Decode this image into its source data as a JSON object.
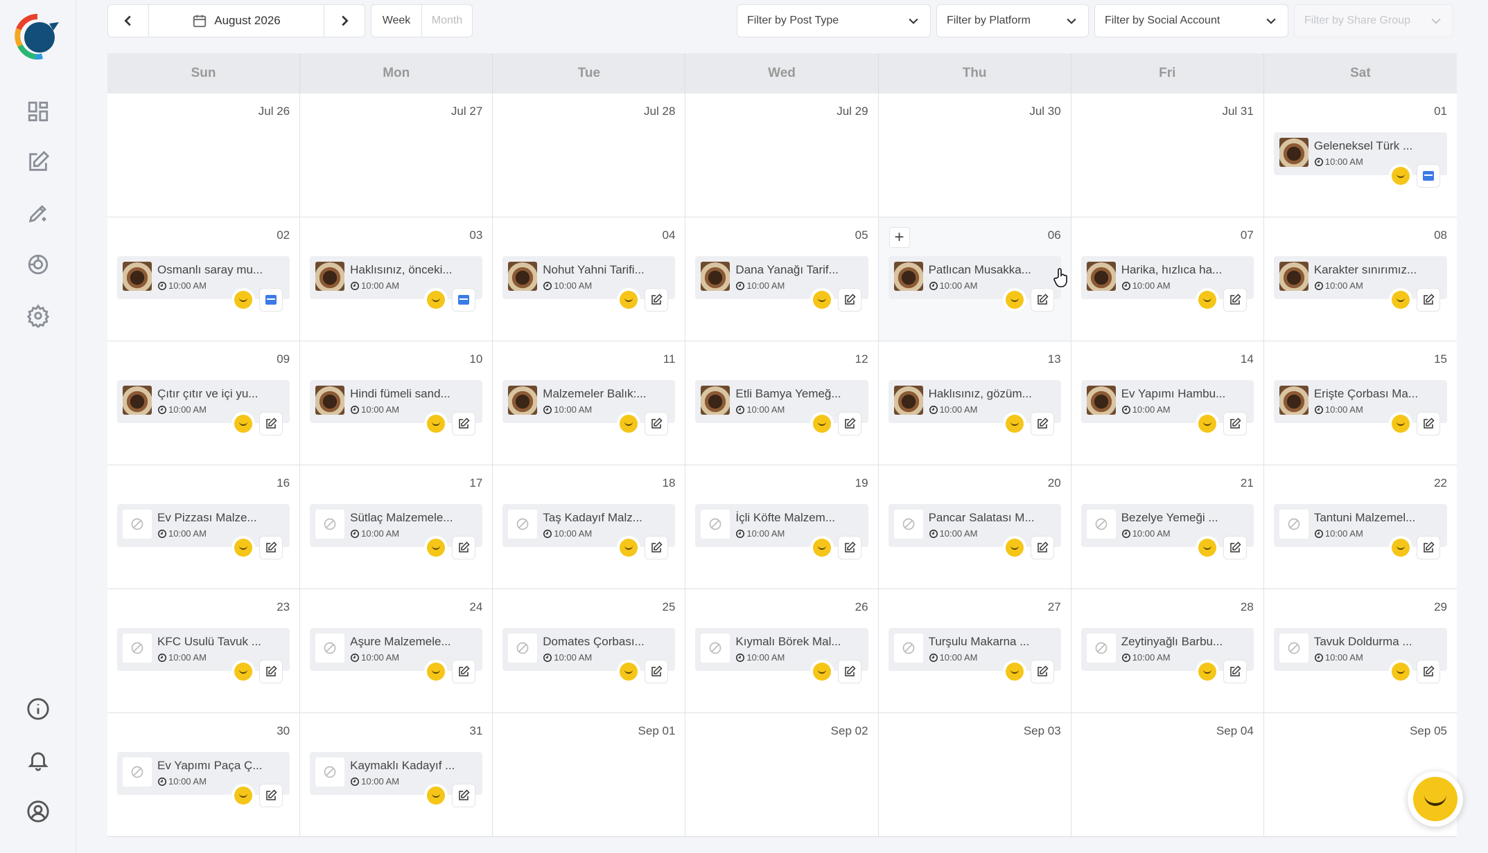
{
  "sidebar": {
    "items": [
      {
        "name": "dashboard-icon"
      },
      {
        "name": "compose-icon"
      },
      {
        "name": "ai-write-icon"
      },
      {
        "name": "analytics-icon"
      },
      {
        "name": "settings-icon"
      }
    ],
    "bottom": [
      {
        "name": "info-icon"
      },
      {
        "name": "bell-icon"
      },
      {
        "name": "user-icon"
      }
    ]
  },
  "toolbar": {
    "current_period": "August 2026",
    "views": [
      "Week",
      "Month"
    ],
    "active_view": "Week",
    "filters": [
      {
        "label": "Filter by Post Type",
        "disabled": false
      },
      {
        "label": "Filter by Platform",
        "disabled": false
      },
      {
        "label": "Filter by Social Account",
        "disabled": false
      },
      {
        "label": "Filter by Share Group",
        "disabled": true
      }
    ]
  },
  "calendar": {
    "weekdays": [
      "Sun",
      "Mon",
      "Tue",
      "Wed",
      "Thu",
      "Fri",
      "Sat"
    ],
    "days": [
      {
        "label": "Jul 26"
      },
      {
        "label": "Jul 27"
      },
      {
        "label": "Jul 28"
      },
      {
        "label": "Jul 29"
      },
      {
        "label": "Jul 30"
      },
      {
        "label": "Jul 31"
      },
      {
        "label": "01",
        "post": {
          "title": "Geleneksel Türk ...",
          "time": "10:00 AM",
          "image": true,
          "action": "gmb"
        }
      },
      {
        "label": "02",
        "post": {
          "title": "Osmanlı saray mu...",
          "time": "10:00 AM",
          "image": true,
          "action": "gmb"
        }
      },
      {
        "label": "03",
        "post": {
          "title": "Haklısınız, önceki...",
          "time": "10:00 AM",
          "image": true,
          "action": "gmb"
        }
      },
      {
        "label": "04",
        "post": {
          "title": "Nohut Yahni Tarifi...",
          "time": "10:00 AM",
          "image": true,
          "action": "edit"
        }
      },
      {
        "label": "05",
        "post": {
          "title": "Dana Yanağı Tarif...",
          "time": "10:00 AM",
          "image": true,
          "action": "edit"
        }
      },
      {
        "label": "06",
        "hover": true,
        "post": {
          "title": "Patlıcan Musakka...",
          "time": "10:00 AM",
          "image": true,
          "action": "edit"
        }
      },
      {
        "label": "07",
        "post": {
          "title": "Harika, hızlıca ha...",
          "time": "10:00 AM",
          "image": true,
          "action": "edit"
        }
      },
      {
        "label": "08",
        "post": {
          "title": "Karakter sınırımız...",
          "time": "10:00 AM",
          "image": true,
          "action": "edit"
        }
      },
      {
        "label": "09",
        "post": {
          "title": "Çıtır çıtır ve içi yu...",
          "time": "10:00 AM",
          "image": true,
          "action": "edit"
        }
      },
      {
        "label": "10",
        "post": {
          "title": "Hindi fümeli sand...",
          "time": "10:00 AM",
          "image": true,
          "action": "edit"
        }
      },
      {
        "label": "11",
        "post": {
          "title": "Malzemeler Balık:...",
          "time": "10:00 AM",
          "image": true,
          "action": "edit"
        }
      },
      {
        "label": "12",
        "post": {
          "title": "Etli Bamya Yemeğ...",
          "time": "10:00 AM",
          "image": true,
          "action": "edit"
        }
      },
      {
        "label": "13",
        "post": {
          "title": "Haklısınız, gözüm...",
          "time": "10:00 AM",
          "image": true,
          "action": "edit"
        }
      },
      {
        "label": "14",
        "post": {
          "title": "Ev Yapımı Hambu...",
          "time": "10:00 AM",
          "image": true,
          "action": "edit"
        }
      },
      {
        "label": "15",
        "post": {
          "title": "Erişte Çorbası Ma...",
          "time": "10:00 AM",
          "image": true,
          "action": "edit"
        }
      },
      {
        "label": "16",
        "post": {
          "title": "Ev Pizzası Malze...",
          "time": "10:00 AM",
          "image": false,
          "action": "edit"
        }
      },
      {
        "label": "17",
        "post": {
          "title": "Sütlaç Malzemele...",
          "time": "10:00 AM",
          "image": false,
          "action": "edit"
        }
      },
      {
        "label": "18",
        "post": {
          "title": "Taş Kadayıf Malz...",
          "time": "10:00 AM",
          "image": false,
          "action": "edit"
        }
      },
      {
        "label": "19",
        "post": {
          "title": "İçli Köfte Malzem...",
          "time": "10:00 AM",
          "image": false,
          "action": "edit"
        }
      },
      {
        "label": "20",
        "post": {
          "title": "Pancar Salatası M...",
          "time": "10:00 AM",
          "image": false,
          "action": "edit"
        }
      },
      {
        "label": "21",
        "post": {
          "title": "Bezelye Yemeği ...",
          "time": "10:00 AM",
          "image": false,
          "action": "edit"
        }
      },
      {
        "label": "22",
        "post": {
          "title": "Tantuni Malzemel...",
          "time": "10:00 AM",
          "image": false,
          "action": "edit"
        }
      },
      {
        "label": "23",
        "post": {
          "title": "KFC Usulü Tavuk ...",
          "time": "10:00 AM",
          "image": false,
          "action": "edit"
        }
      },
      {
        "label": "24",
        "post": {
          "title": "Aşure Malzemele...",
          "time": "10:00 AM",
          "image": false,
          "action": "edit"
        }
      },
      {
        "label": "25",
        "post": {
          "title": "Domates Çorbası...",
          "time": "10:00 AM",
          "image": false,
          "action": "edit"
        }
      },
      {
        "label": "26",
        "post": {
          "title": "Kıymalı Börek Mal...",
          "time": "10:00 AM",
          "image": false,
          "action": "edit"
        }
      },
      {
        "label": "27",
        "post": {
          "title": "Turşulu Makarna ...",
          "time": "10:00 AM",
          "image": false,
          "action": "edit"
        }
      },
      {
        "label": "28",
        "post": {
          "title": "Zeytinyağlı Barbu...",
          "time": "10:00 AM",
          "image": false,
          "action": "edit"
        }
      },
      {
        "label": "29",
        "post": {
          "title": "Tavuk Doldurma ...",
          "time": "10:00 AM",
          "image": false,
          "action": "edit"
        }
      },
      {
        "label": "30",
        "post": {
          "title": "Ev Yapımı Paça Ç...",
          "time": "10:00 AM",
          "image": false,
          "action": "edit"
        }
      },
      {
        "label": "31",
        "post": {
          "title": "Kaymaklı Kadayıf ...",
          "time": "10:00 AM",
          "image": false,
          "action": "edit"
        }
      },
      {
        "label": "Sep 01"
      },
      {
        "label": "Sep 02"
      },
      {
        "label": "Sep 03"
      },
      {
        "label": "Sep 04"
      },
      {
        "label": "Sep 05"
      }
    ]
  },
  "colors": {
    "accent": "#f5c518",
    "gmb": "#3b7be6",
    "header_bg": "#e9eaed"
  }
}
